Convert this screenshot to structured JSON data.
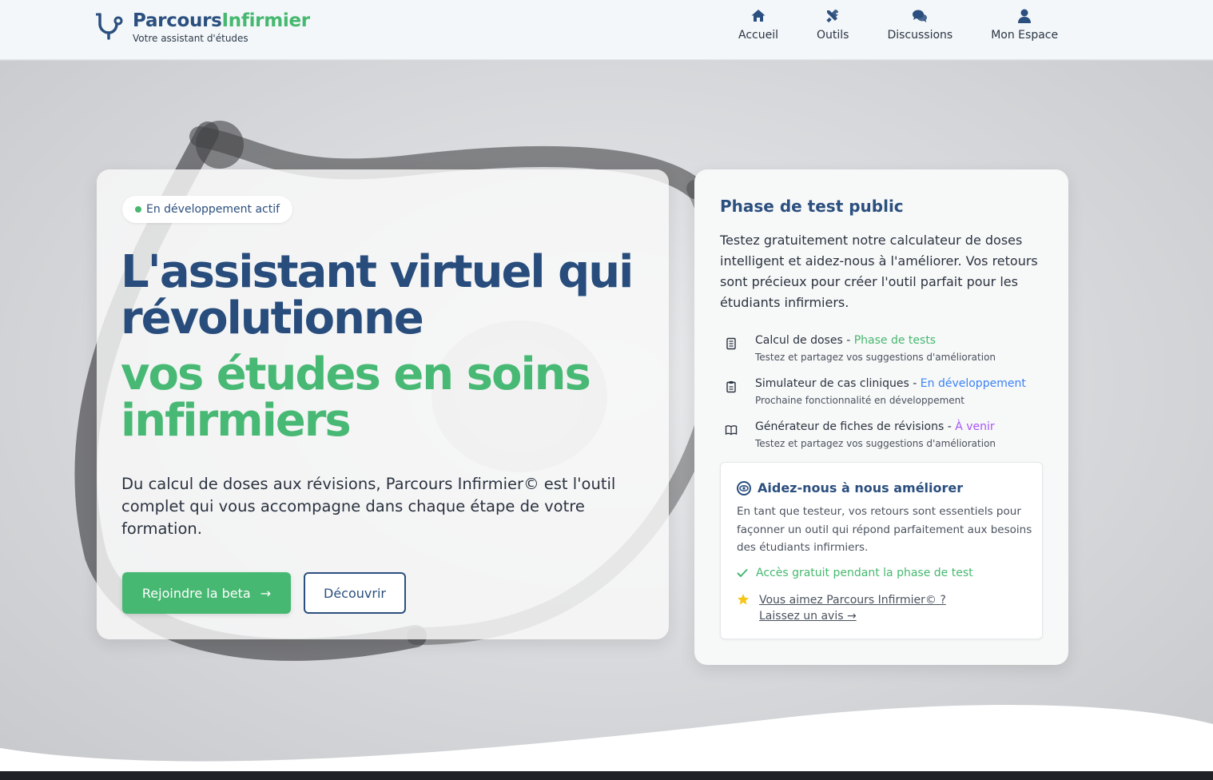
{
  "brand": {
    "name_part1": "Parcours",
    "name_part2": "Infirmier",
    "tagline": "Votre assistant d'études"
  },
  "nav": [
    {
      "label": "Accueil",
      "icon": "home-icon"
    },
    {
      "label": "Outils",
      "icon": "tools-icon"
    },
    {
      "label": "Discussions",
      "icon": "chat-icon"
    },
    {
      "label": "Mon Espace",
      "icon": "user-icon"
    }
  ],
  "hero": {
    "badge": "En développement actif",
    "headline_line1": "L'assistant virtuel qui",
    "headline_line2": "révolutionne",
    "headline_line3": "vos études en soins",
    "headline_line4": "infirmiers",
    "lead": "Du calcul de doses aux révisions, Parcours Infirmier© est l'outil complet qui vous accompagne dans chaque étape de votre formation.",
    "primary_button": "Rejoindre la beta",
    "primary_arrow": "→",
    "secondary_button": "Découvrir"
  },
  "test_phase": {
    "title": "Phase de test public",
    "text": "Testez gratuitement notre calculateur de doses intelligent et aidez-nous à l'améliorer. Vos retours sont précieux pour créer l'outil parfait pour les étudiants infirmiers.",
    "features": [
      {
        "name": "Calcul de doses",
        "sep": " - ",
        "status": "Phase de tests",
        "status_color": "#46b86f",
        "sub": "Testez et partagez vos suggestions d'amélioration",
        "icon": "calculator-icon"
      },
      {
        "name": "Simulateur de cas cliniques",
        "sep": " - ",
        "status": "En développement",
        "status_color": "#3b82f6",
        "sub": "Prochaine fonctionnalité en développement",
        "icon": "clipboard-icon"
      },
      {
        "name": "Générateur de fiches de révisions",
        "sep": " - ",
        "status": "À venir",
        "status_color": "#a855f7",
        "sub": "Testez et partagez vos suggestions d'amélioration",
        "icon": "book-icon"
      }
    ],
    "help": {
      "title": "Aidez-nous à nous améliorer",
      "text": "En tant que testeur, vos retours sont essentiels pour façonner un outil qui répond parfaitement aux besoins des étudiants infirmiers.",
      "check": "Accès gratuit pendant la phase de test",
      "link_line1": "Vous aimez Parcours Infirmier© ?",
      "link_line2": "Laissez un avis →"
    }
  },
  "colors": {
    "primary_blue": "#2b4f7e",
    "primary_green": "#46b86f",
    "status_blue": "#3b82f6",
    "status_purple": "#a855f7",
    "star": "#f5c518"
  }
}
